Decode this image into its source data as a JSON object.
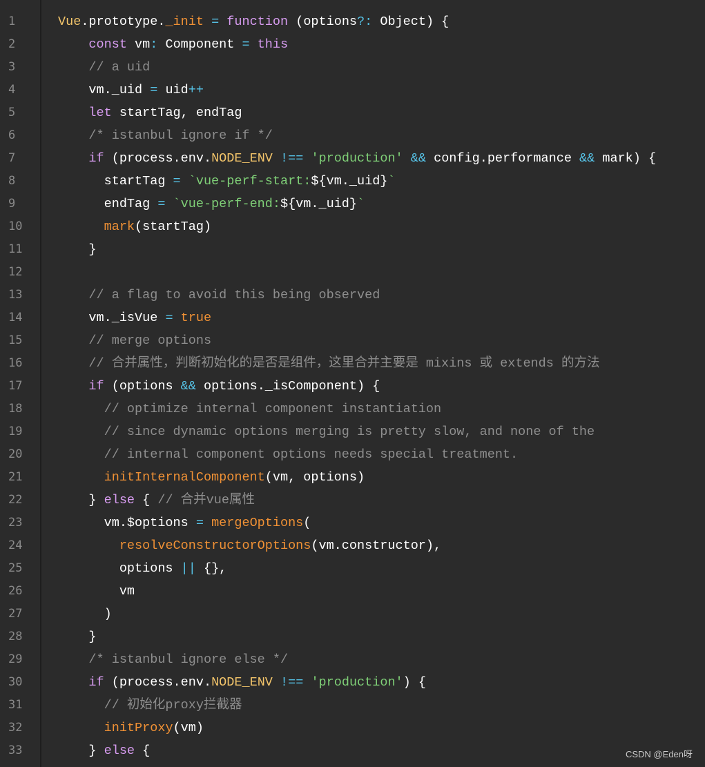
{
  "editor": {
    "lines": [
      {
        "n": "1",
        "tokens": [
          [
            "Vue",
            "t-ty"
          ],
          [
            ".prototype.",
            "t-pl"
          ],
          [
            "_init",
            "t-fn"
          ],
          [
            " ",
            "t-pl"
          ],
          [
            "=",
            "t-op"
          ],
          [
            " ",
            "t-pl"
          ],
          [
            "function",
            "t-key"
          ],
          [
            " (options",
            "t-pl"
          ],
          [
            "?:",
            "t-op"
          ],
          [
            " Object) {",
            "t-pl"
          ]
        ]
      },
      {
        "n": "2",
        "tokens": [
          [
            "    ",
            "t-pl"
          ],
          [
            "const",
            "t-key"
          ],
          [
            " vm",
            "t-pl"
          ],
          [
            ":",
            "t-op"
          ],
          [
            " Component ",
            "t-pl"
          ],
          [
            "=",
            "t-op"
          ],
          [
            " ",
            "t-pl"
          ],
          [
            "this",
            "t-key"
          ]
        ]
      },
      {
        "n": "3",
        "tokens": [
          [
            "    ",
            "t-pl"
          ],
          [
            "// a uid",
            "t-com"
          ]
        ]
      },
      {
        "n": "4",
        "tokens": [
          [
            "    vm._uid ",
            "t-pl"
          ],
          [
            "=",
            "t-op"
          ],
          [
            " uid",
            "t-pl"
          ],
          [
            "++",
            "t-op"
          ]
        ]
      },
      {
        "n": "5",
        "tokens": [
          [
            "    ",
            "t-pl"
          ],
          [
            "let",
            "t-key"
          ],
          [
            " startTag, endTag",
            "t-pl"
          ]
        ]
      },
      {
        "n": "6",
        "tokens": [
          [
            "    ",
            "t-pl"
          ],
          [
            "/* istanbul ignore if */",
            "t-com"
          ]
        ]
      },
      {
        "n": "7",
        "tokens": [
          [
            "    ",
            "t-pl"
          ],
          [
            "if",
            "t-key"
          ],
          [
            " (process.env.",
            "t-pl"
          ],
          [
            "NODE_ENV",
            "t-ty"
          ],
          [
            " ",
            "t-pl"
          ],
          [
            "!==",
            "t-op"
          ],
          [
            " ",
            "t-pl"
          ],
          [
            "'production'",
            "t-str"
          ],
          [
            " ",
            "t-pl"
          ],
          [
            "&&",
            "t-op"
          ],
          [
            " config.performance ",
            "t-pl"
          ],
          [
            "&&",
            "t-op"
          ],
          [
            " mark) {",
            "t-pl"
          ]
        ]
      },
      {
        "n": "8",
        "tokens": [
          [
            "      startTag ",
            "t-pl"
          ],
          [
            "=",
            "t-op"
          ],
          [
            " ",
            "t-pl"
          ],
          [
            "`vue-perf-start:",
            "t-str"
          ],
          [
            "${vm._uid}",
            "t-pl"
          ],
          [
            "`",
            "t-str"
          ]
        ]
      },
      {
        "n": "9",
        "tokens": [
          [
            "      endTag ",
            "t-pl"
          ],
          [
            "=",
            "t-op"
          ],
          [
            " ",
            "t-pl"
          ],
          [
            "`vue-perf-end:",
            "t-str"
          ],
          [
            "${vm._uid}",
            "t-pl"
          ],
          [
            "`",
            "t-str"
          ]
        ]
      },
      {
        "n": "10",
        "tokens": [
          [
            "      ",
            "t-pl"
          ],
          [
            "mark",
            "t-fn"
          ],
          [
            "(startTag)",
            "t-pl"
          ]
        ]
      },
      {
        "n": "11",
        "tokens": [
          [
            "    }",
            "t-pl"
          ]
        ]
      },
      {
        "n": "12",
        "tokens": []
      },
      {
        "n": "13",
        "tokens": [
          [
            "    ",
            "t-pl"
          ],
          [
            "// a flag to avoid this being observed",
            "t-com"
          ]
        ]
      },
      {
        "n": "14",
        "tokens": [
          [
            "    vm._isVue ",
            "t-pl"
          ],
          [
            "=",
            "t-op"
          ],
          [
            " ",
            "t-pl"
          ],
          [
            "true",
            "t-cst"
          ]
        ]
      },
      {
        "n": "15",
        "tokens": [
          [
            "    ",
            "t-pl"
          ],
          [
            "// merge options",
            "t-com"
          ]
        ]
      },
      {
        "n": "16",
        "tokens": [
          [
            "    ",
            "t-pl"
          ],
          [
            "// 合并属性，判断初始化的是否是组件，这里合并主要是 mixins 或 extends 的方法",
            "t-com"
          ]
        ]
      },
      {
        "n": "17",
        "tokens": [
          [
            "    ",
            "t-pl"
          ],
          [
            "if",
            "t-key"
          ],
          [
            " (options ",
            "t-pl"
          ],
          [
            "&&",
            "t-op"
          ],
          [
            " options._isComponent) {",
            "t-pl"
          ]
        ]
      },
      {
        "n": "18",
        "tokens": [
          [
            "      ",
            "t-pl"
          ],
          [
            "// optimize internal component instantiation",
            "t-com"
          ]
        ]
      },
      {
        "n": "19",
        "tokens": [
          [
            "      ",
            "t-pl"
          ],
          [
            "// since dynamic options merging is pretty slow, and none of the",
            "t-com"
          ]
        ]
      },
      {
        "n": "20",
        "tokens": [
          [
            "      ",
            "t-pl"
          ],
          [
            "// internal component options needs special treatment.",
            "t-com"
          ]
        ]
      },
      {
        "n": "21",
        "tokens": [
          [
            "      ",
            "t-pl"
          ],
          [
            "initInternalComponent",
            "t-fn"
          ],
          [
            "(vm, options)",
            "t-pl"
          ]
        ]
      },
      {
        "n": "22",
        "tokens": [
          [
            "    } ",
            "t-pl"
          ],
          [
            "else",
            "t-key"
          ],
          [
            " { ",
            "t-pl"
          ],
          [
            "// 合并vue属性",
            "t-com"
          ]
        ]
      },
      {
        "n": "23",
        "tokens": [
          [
            "      vm.$options ",
            "t-pl"
          ],
          [
            "=",
            "t-op"
          ],
          [
            " ",
            "t-pl"
          ],
          [
            "mergeOptions",
            "t-fn"
          ],
          [
            "(",
            "t-pl"
          ]
        ]
      },
      {
        "n": "24",
        "tokens": [
          [
            "        ",
            "t-pl"
          ],
          [
            "resolveConstructorOptions",
            "t-fn"
          ],
          [
            "(vm.constructor),",
            "t-pl"
          ]
        ]
      },
      {
        "n": "25",
        "tokens": [
          [
            "        options ",
            "t-pl"
          ],
          [
            "||",
            "t-op"
          ],
          [
            " {},",
            "t-pl"
          ]
        ]
      },
      {
        "n": "26",
        "tokens": [
          [
            "        vm",
            "t-pl"
          ]
        ]
      },
      {
        "n": "27",
        "tokens": [
          [
            "      )",
            "t-pl"
          ]
        ]
      },
      {
        "n": "28",
        "tokens": [
          [
            "    }",
            "t-pl"
          ]
        ]
      },
      {
        "n": "29",
        "tokens": [
          [
            "    ",
            "t-pl"
          ],
          [
            "/* istanbul ignore else */",
            "t-com"
          ]
        ]
      },
      {
        "n": "30",
        "tokens": [
          [
            "    ",
            "t-pl"
          ],
          [
            "if",
            "t-key"
          ],
          [
            " (process.env.",
            "t-pl"
          ],
          [
            "NODE_ENV",
            "t-ty"
          ],
          [
            " ",
            "t-pl"
          ],
          [
            "!==",
            "t-op"
          ],
          [
            " ",
            "t-pl"
          ],
          [
            "'production'",
            "t-str"
          ],
          [
            ") {",
            "t-pl"
          ]
        ]
      },
      {
        "n": "31",
        "tokens": [
          [
            "      ",
            "t-pl"
          ],
          [
            "// 初始化proxy拦截器",
            "t-com"
          ]
        ]
      },
      {
        "n": "32",
        "tokens": [
          [
            "      ",
            "t-pl"
          ],
          [
            "initProxy",
            "t-fn"
          ],
          [
            "(vm)",
            "t-pl"
          ]
        ]
      },
      {
        "n": "33",
        "tokens": [
          [
            "    } ",
            "t-pl"
          ],
          [
            "else",
            "t-key"
          ],
          [
            " {",
            "t-pl"
          ]
        ]
      }
    ]
  },
  "watermark": "CSDN @Eden呀"
}
